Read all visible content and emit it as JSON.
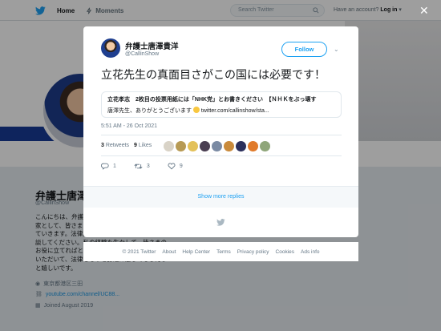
{
  "nav": {
    "home_label": "Home",
    "moments_label": "Moments",
    "search_placeholder": "Search Twitter",
    "account_prompt": "Have an account?",
    "login_label": "Log in"
  },
  "profile": {
    "name": "弁護士唐澤貴洋",
    "handle": "@CallinShow",
    "bio": "こんにちは、弁護士 唐澤貴洋です。法律の専門家として、皆さまに役に立つ様々な情報を発信していきます。法律問題で悩み相談など、気軽に相談してください。私の経験を生かして、皆さまのお役に立てればと思っています。お気軽にご相談いただいて、法律をもっと身近に感じてもらえると嬉しいです。",
    "location": "東京都港区三田",
    "website": "youtube.com/channel/UC88...",
    "joined": "Joined August 2019"
  },
  "tweet": {
    "author_name": "弁護士唐澤貴洋",
    "author_handle": "@CallinShow",
    "follow_label": "Follow",
    "text": "立花先生の真面目さがこの国には必要です！",
    "quote_title": "立花孝志　2枚目の投票用紙には「NHK党」とお書きください　【ＮＨＫをぶっ壊す",
    "quote_text_prefix": "唐澤先生、ありがとうございます",
    "quote_link": "twitter.com/callinshow/sta...",
    "timestamp": "5:51 AM - 26 Oct 2021",
    "retweets_count": "3",
    "retweets_label": "Retweets",
    "likes_count": "9",
    "likes_label": "Likes",
    "reply_count": "1",
    "retweet_action_count": "3",
    "like_action_count": "9",
    "show_more_label": "Show more replies"
  },
  "footer": {
    "links": [
      "© 2021 Twitter",
      "About",
      "Help Center",
      "Terms",
      "Privacy policy",
      "Cookies",
      "Ads info"
    ]
  },
  "colors": {
    "accent": "#1da1f2",
    "banner_band": "#173b96"
  },
  "liker_colors": [
    "#d9d3c7",
    "#b79a54",
    "#e3c15a",
    "#4a3f52",
    "#7a8aa3",
    "#c98a3b",
    "#2b2f5c",
    "#e07a2a",
    "#8fa67a"
  ]
}
